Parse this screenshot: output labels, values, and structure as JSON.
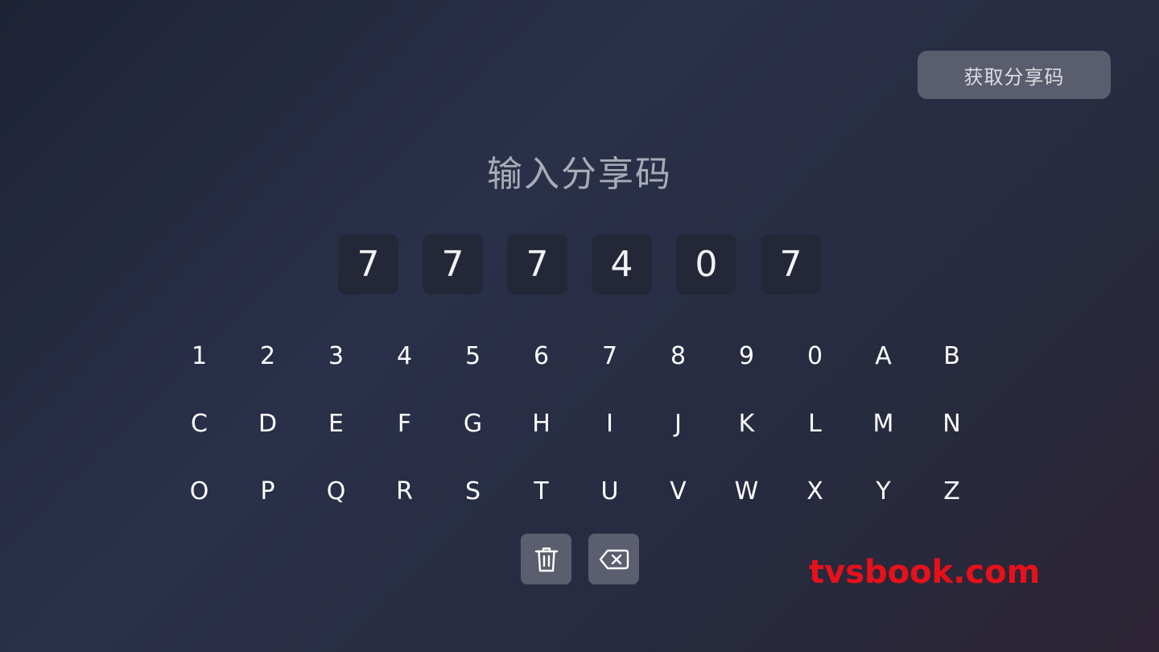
{
  "header": {
    "get_code_label": "获取分享码"
  },
  "title": "输入分享码",
  "code_digits": [
    "7",
    "7",
    "7",
    "4",
    "0",
    "7"
  ],
  "keyboard": {
    "rows": [
      [
        "1",
        "2",
        "3",
        "4",
        "5",
        "6",
        "7",
        "8",
        "9",
        "0",
        "A",
        "B"
      ],
      [
        "C",
        "D",
        "E",
        "F",
        "G",
        "H",
        "I",
        "J",
        "K",
        "L",
        "M",
        "N"
      ],
      [
        "O",
        "P",
        "Q",
        "R",
        "S",
        "T",
        "U",
        "V",
        "W",
        "X",
        "Y",
        "Z"
      ]
    ]
  },
  "actions": {
    "clear_icon": "trash-icon",
    "backspace_icon": "backspace-icon"
  },
  "watermark": "tvsbook.com"
}
